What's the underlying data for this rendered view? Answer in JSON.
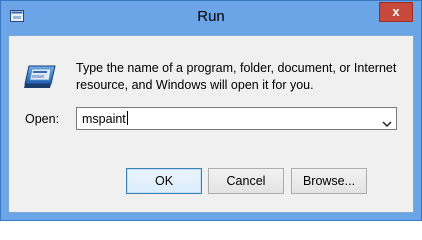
{
  "window": {
    "title": "Run",
    "close_glyph": "x",
    "app_icon": "run-app-icon"
  },
  "dialog": {
    "icon": "run-program-icon",
    "message": "Type the name of a program, folder, document, or Internet resource, and Windows will open it for you.",
    "open_label": "Open:",
    "open_value": "mspaint",
    "dropdown_icon": "chevron-down-icon"
  },
  "buttons": {
    "ok_label": "OK",
    "cancel_label": "Cancel",
    "browse_label": "Browse..."
  },
  "colors": {
    "titlebar": "#6ba5e8",
    "close_button": "#c7493c",
    "dialog_background": "#f0f0f0",
    "default_button_border": "#3c7fb1"
  }
}
